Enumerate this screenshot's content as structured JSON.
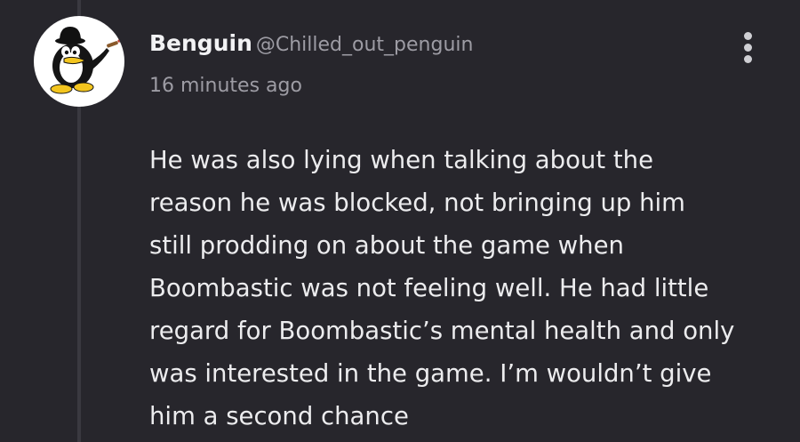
{
  "post": {
    "author": {
      "display_name": "Benguin",
      "handle": "@Chilled_out_penguin",
      "avatar_icon": "penguin-with-bowler-hat-and-cigar"
    },
    "timestamp": "16 minutes ago",
    "menu_icon": "more-vertical-icon",
    "body_lines": [
      "He was also lying when talking about the",
      "reason he was blocked, not bringing up him",
      "still prodding on about the game when",
      "Boombastic was not feeling well. He had little",
      "regard for Boombastic’s mental health and only",
      "was interested in the game. I’m wouldn’t give",
      "him a second chance"
    ]
  },
  "colors": {
    "background": "#27262c",
    "thread_line": "#3a3940",
    "text_primary": "#ececee",
    "text_secondary": "#9d9ca4",
    "avatar_accent": "#f3c51e"
  }
}
